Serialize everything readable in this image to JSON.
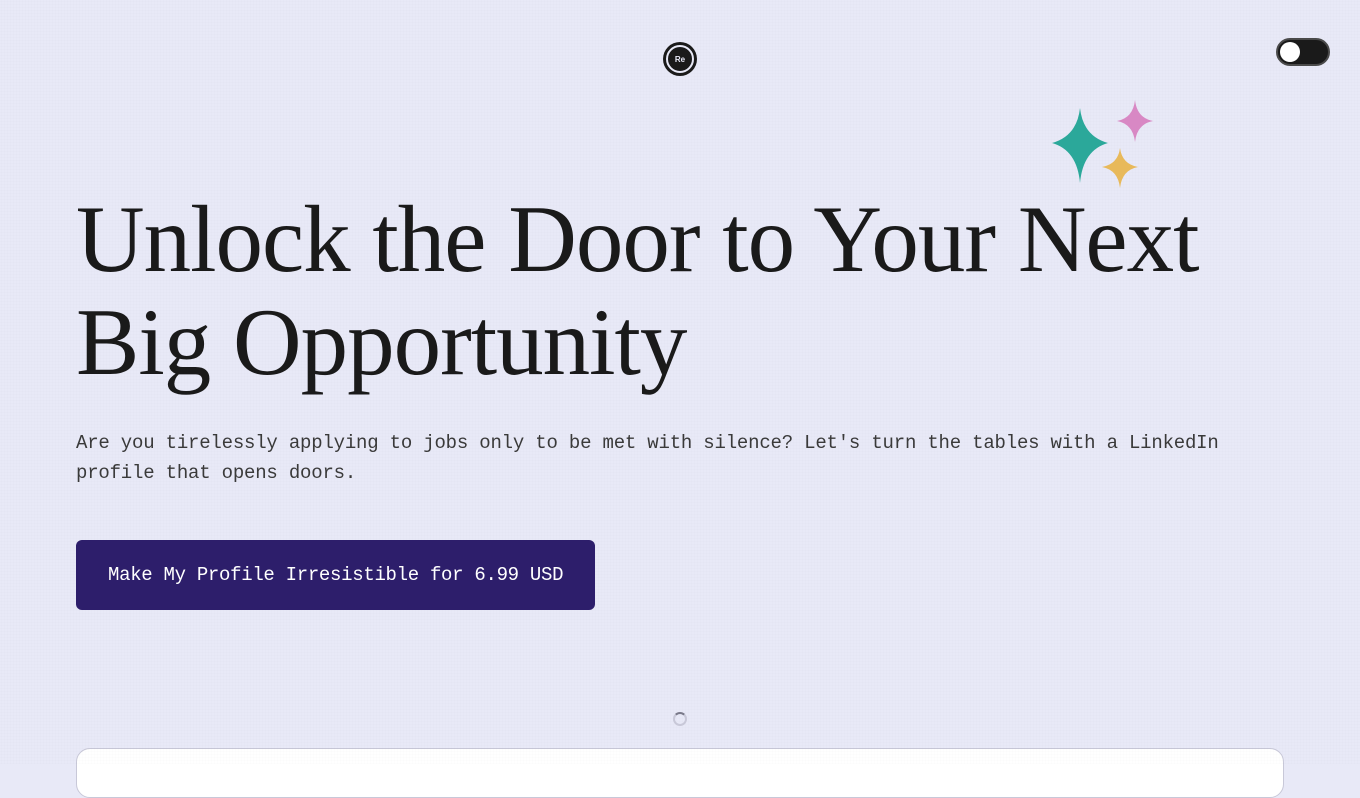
{
  "logo": {
    "text": "Re"
  },
  "toggle": {
    "state": "off"
  },
  "headline": "Unlock the Door to Your Next Big Opportunity",
  "subtext": "Are you tirelessly applying to jobs only to be met with silence? Let's turn the tables with a LinkedIn profile that opens doors.",
  "cta": {
    "label": "Make My Profile Irresistible for 6.99 USD"
  },
  "icons": {
    "sparkle_colors": {
      "large": "#2ba89a",
      "top_right": "#d888c4",
      "bottom": "#e8b95a"
    }
  }
}
